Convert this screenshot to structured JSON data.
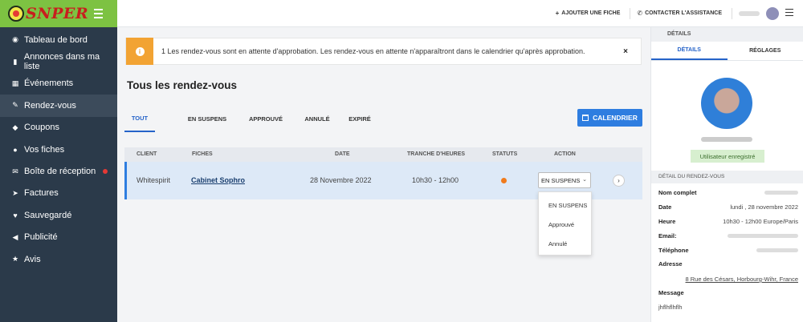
{
  "brand": {
    "logo_text": "SNPER",
    "accent": "#7dc242"
  },
  "sidebar": {
    "items": [
      {
        "label": "Tableau de bord",
        "icon": "dashboard-icon",
        "glyph": "◉"
      },
      {
        "label": "Annonces dans ma liste",
        "icon": "microphone-icon",
        "glyph": "▮"
      },
      {
        "label": "Événements",
        "icon": "calendar-icon",
        "glyph": "▦"
      },
      {
        "label": "Rendez-vous",
        "icon": "edit-icon",
        "glyph": "✎"
      },
      {
        "label": "Coupons",
        "icon": "tag-icon",
        "glyph": "◆"
      },
      {
        "label": "Vos fiches",
        "icon": "map-marker-icon",
        "glyph": "●"
      },
      {
        "label": "Boîte de réception",
        "icon": "envelope-icon",
        "glyph": "✉"
      },
      {
        "label": "Factures",
        "icon": "paper-plane-icon",
        "glyph": "➤"
      },
      {
        "label": "Sauvegardé",
        "icon": "heart-icon",
        "glyph": "♥"
      },
      {
        "label": "Publicité",
        "icon": "bullhorn-icon",
        "glyph": "◀"
      },
      {
        "label": "Avis",
        "icon": "star-icon",
        "glyph": "★"
      }
    ]
  },
  "topbar": {
    "add_listing": "AJOUTER UNE FICHE",
    "contact_support": "CONTACTER L'ASSISTANCE"
  },
  "alert": {
    "text": "1 Les rendez-vous sont en attente d'approbation. Les rendez-vous en attente n'apparaîtront dans le calendrier qu'après approbation.",
    "close": "×"
  },
  "main": {
    "title": "Tous les rendez-vous",
    "tabs": [
      "TOUT",
      "EN SUSPENS",
      "APPROUVÉ",
      "ANNULÉ",
      "EXPIRÉ"
    ],
    "calendar_button": "CALENDRIER"
  },
  "table": {
    "headers": [
      "CLIENT",
      "FICHES",
      "DATE",
      "TRANCHE D'HEURES",
      "STATUTS",
      "ACTION"
    ],
    "rows": [
      {
        "client": "Whitespirit",
        "fiche": "Cabinet Sophro",
        "date": "28 Novembre 2022",
        "tranche": "10h30 - 12h00",
        "status_color": "#f07b1c",
        "action_value": "EN SUSPENS"
      }
    ]
  },
  "dropdown": {
    "options": [
      "EN SUSPENS",
      "Approuvé",
      "Annulé"
    ]
  },
  "right_panel": {
    "title": "DÉTAILS",
    "tabs": [
      "DÉTAILS",
      "RÉGLAGES"
    ],
    "badge": "Utilisateur enregistré",
    "section": "DÉTAIL DU RENDEZ-VOUS",
    "fields": {
      "nom_label": "Nom complet",
      "date_label": "Date",
      "date_value": "lundi , 28 novembre 2022",
      "heure_label": "Heure",
      "heure_value": "10h30 - 12h00 Europe/Paris",
      "email_label": "Email:",
      "tel_label": "Téléphone",
      "adresse_label": "Adresse",
      "adresse_value": "8 Rue des Césars, Horbourg-Wihr, France",
      "message_label": "Message",
      "message_value": "jhflhflhflh"
    }
  }
}
